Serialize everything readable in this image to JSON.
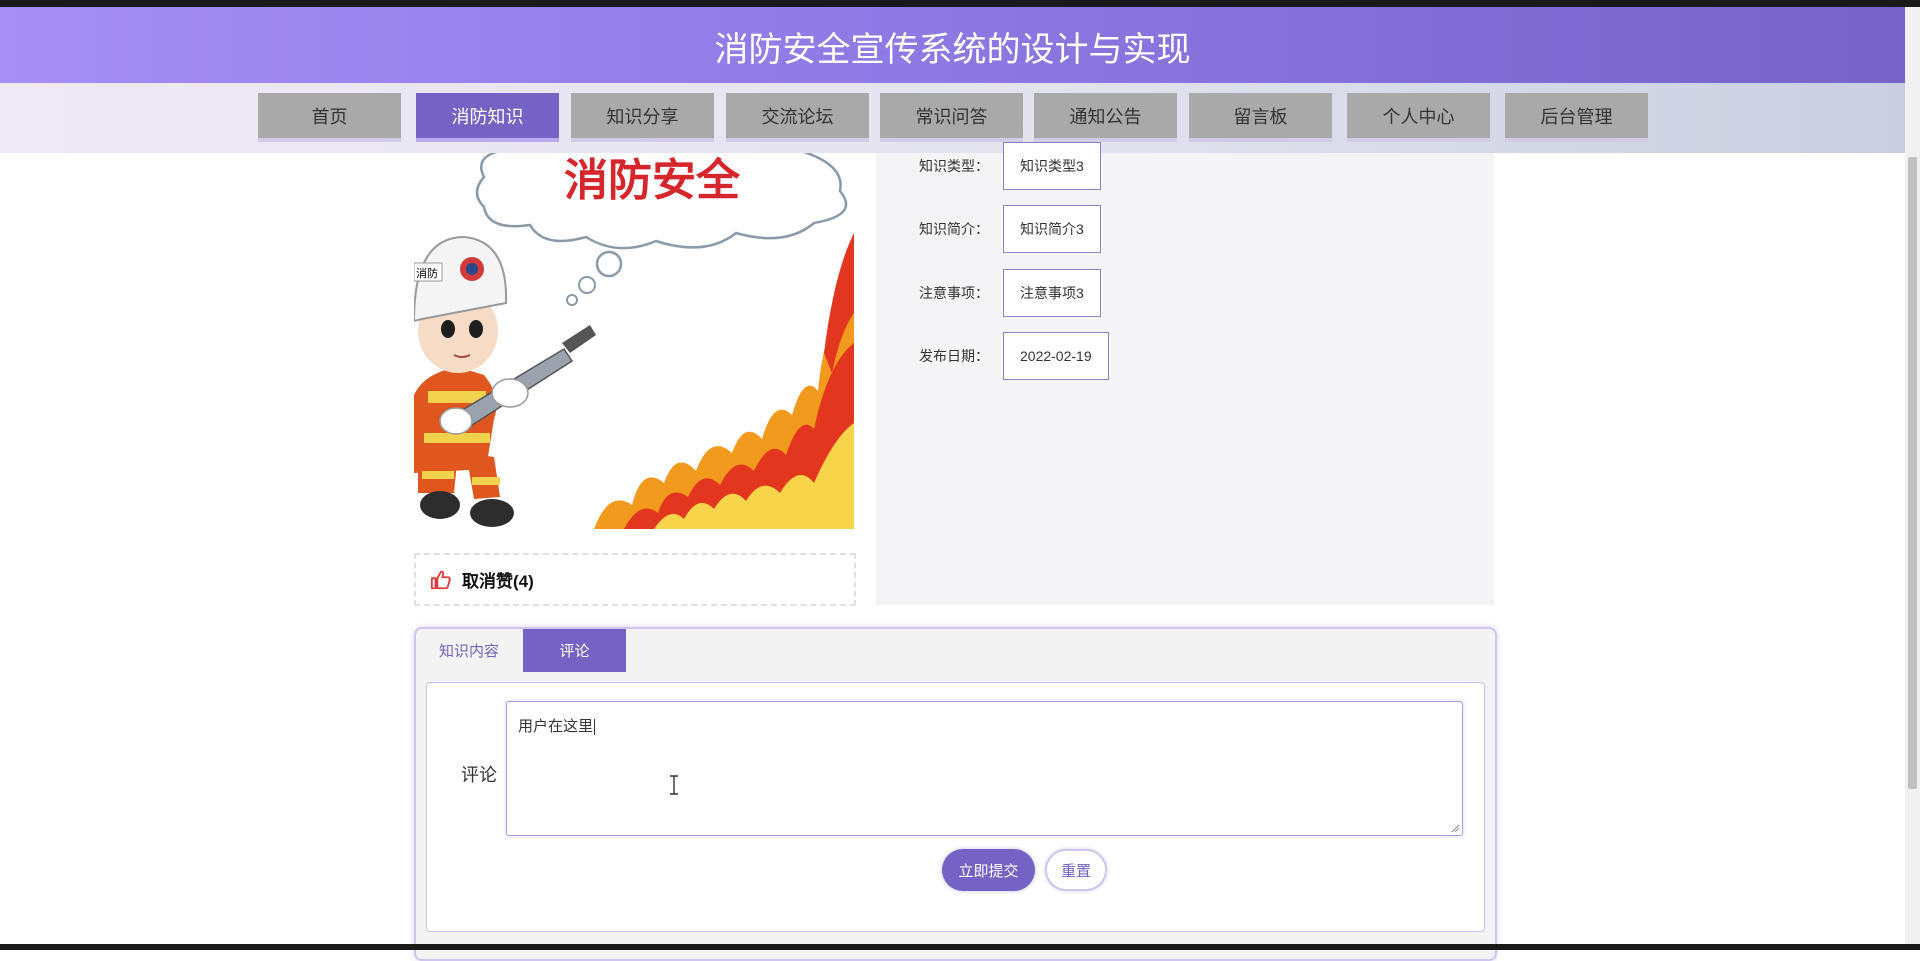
{
  "site": {
    "title": "消防安全宣传系统的设计与实现"
  },
  "nav": {
    "items": [
      {
        "label": "首页",
        "active": false
      },
      {
        "label": "消防知识",
        "active": true
      },
      {
        "label": "知识分享",
        "active": false
      },
      {
        "label": "交流论坛",
        "active": false
      },
      {
        "label": "常识问答",
        "active": false
      },
      {
        "label": "通知公告",
        "active": false
      },
      {
        "label": "留言板",
        "active": false
      },
      {
        "label": "个人中心",
        "active": false
      },
      {
        "label": "后台管理",
        "active": false
      }
    ]
  },
  "hero": {
    "banner_text": "消防安全",
    "badge_text": "消防"
  },
  "like": {
    "label": "取消赞(4)",
    "icon": "thumbs-up-icon"
  },
  "details": [
    {
      "label": "知识类型：",
      "value": "知识类型3"
    },
    {
      "label": "知识简介：",
      "value": "知识简介3"
    },
    {
      "label": "注意事项：",
      "value": "注意事项3"
    },
    {
      "label": "发布日期：",
      "value": "2022-02-19"
    }
  ],
  "tabs": [
    {
      "label": "知识内容",
      "active": false
    },
    {
      "label": "评论",
      "active": true
    }
  ],
  "comment_form": {
    "label": "评论",
    "value": "用户在这里",
    "submit_label": "立即提交",
    "reset_label": "重置"
  },
  "colors": {
    "primary": "#7462c4",
    "header_start": "#a58ff5",
    "header_end": "#7663c8",
    "nav_inactive": "#a9a9a9"
  }
}
